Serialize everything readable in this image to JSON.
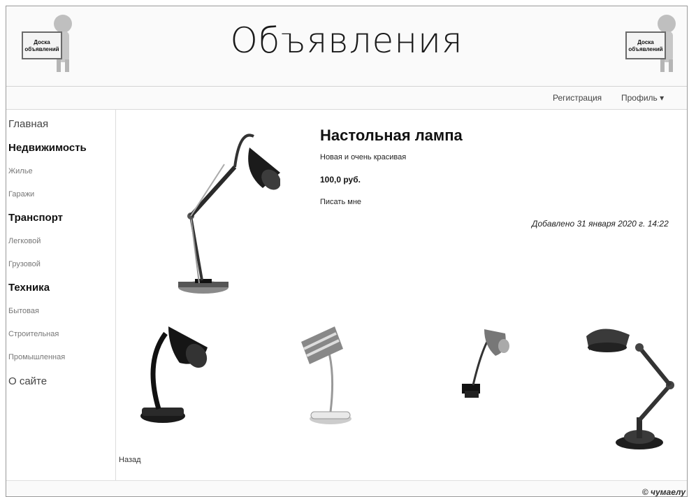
{
  "header": {
    "title": "Объявления",
    "logo_left_text": "Доска объявлений",
    "logo_right_text": "Доска объявлений"
  },
  "navbar": {
    "register": "Регистрация",
    "profile": "Профиль ▾"
  },
  "sidebar": {
    "home": "Главная",
    "categories": [
      {
        "title": "Недвижимость",
        "items": [
          "Жилье",
          "Гаражи"
        ]
      },
      {
        "title": "Транспорт",
        "items": [
          "Легковой",
          "Грузовой"
        ]
      },
      {
        "title": "Техника",
        "items": [
          "Бытовая",
          "Строительная",
          "Промышленная"
        ]
      }
    ],
    "about": "О сайте"
  },
  "ad": {
    "title": "Настольная лампа",
    "description": "Новая и очень красивая",
    "price": "100,0 руб.",
    "contact": "Писать мне",
    "added": "Добавлено 31 января 2020 г. 14:22",
    "back": "Назад"
  },
  "footer": {
    "copyright": "© чумаелу"
  }
}
